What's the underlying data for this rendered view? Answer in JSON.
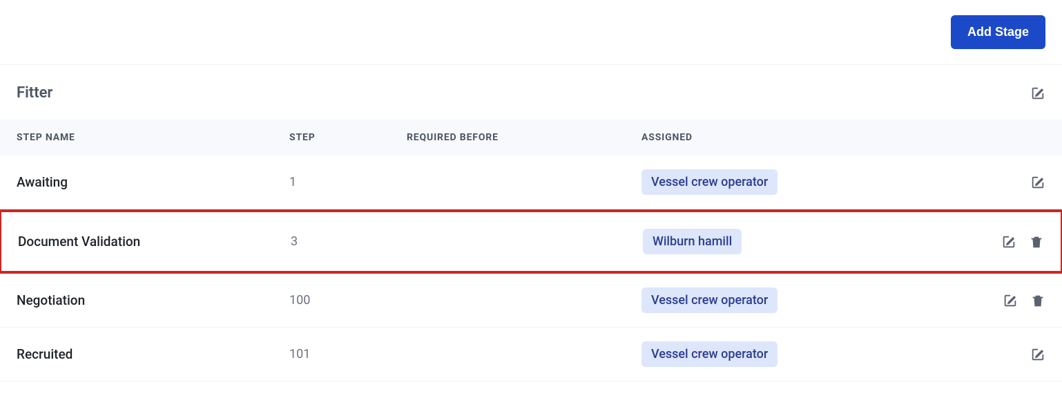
{
  "topbar": {
    "add_stage_label": "Add Stage"
  },
  "section": {
    "title": "Fitter"
  },
  "table": {
    "headers": {
      "step_name": "STEP NAME",
      "step": "STEP",
      "required_before": "REQUIRED BEFORE",
      "assigned": "ASSIGNED"
    },
    "rows": [
      {
        "step_name": "Awaiting",
        "step": "1",
        "required_before": "",
        "assigned": "Vessel crew operator",
        "highlighted": false,
        "can_delete": false
      },
      {
        "step_name": "Document Validation",
        "step": "3",
        "required_before": "",
        "assigned": "Wilburn hamill",
        "highlighted": true,
        "can_delete": true
      },
      {
        "step_name": "Negotiation",
        "step": "100",
        "required_before": "",
        "assigned": "Vessel crew operator",
        "highlighted": false,
        "can_delete": true
      },
      {
        "step_name": "Recruited",
        "step": "101",
        "required_before": "",
        "assigned": "Vessel crew operator",
        "highlighted": false,
        "can_delete": false
      }
    ]
  },
  "icons": {
    "edit": "edit-icon",
    "delete": "trash-icon"
  }
}
